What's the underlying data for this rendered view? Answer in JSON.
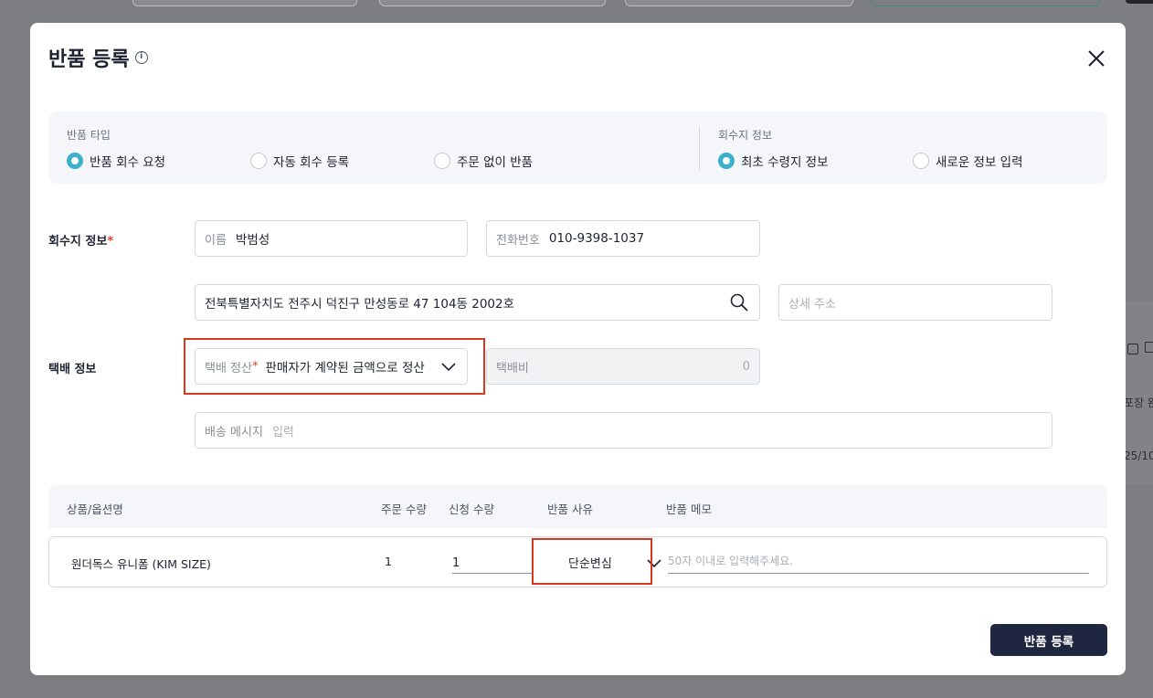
{
  "background": {
    "text_fragments": [
      "포장 완",
      "25/10"
    ]
  },
  "modal": {
    "title": "반품 등록",
    "info_icon": "info-icon",
    "close_icon": "close-icon"
  },
  "return_type": {
    "label": "반품 타입",
    "options": [
      "반품 회수 요청",
      "자동 회수 등록",
      "주문 없이 반품"
    ],
    "selected": "반품 회수 요청"
  },
  "pickup_info": {
    "label": "회수지 정보",
    "options": [
      "최초 수령지 정보",
      "새로운 정보 입력"
    ],
    "selected": "최초 수령지 정보"
  },
  "pickup": {
    "row_label": "회수지 정보",
    "required_mark": "*",
    "name_label": "이름",
    "name_value": "박범성",
    "phone_label": "전화번호",
    "phone_value": "010-9398-1037",
    "address_value": "전북특별자치도 전주시 덕진구 만성동로 47 104동 2002호",
    "detail_address_placeholder": "상세 주소"
  },
  "delivery": {
    "row_label": "택배 정보",
    "settlement_label": "택배 정산",
    "required_mark": "*",
    "settlement_value": "판매자가 계약된 금액으로 정산",
    "fee_label": "택배비",
    "fee_value": "0",
    "message_label": "배송 메시지",
    "message_placeholder": "입력"
  },
  "table": {
    "headers": [
      "상품/옵션명",
      "주문 수량",
      "신청 수량",
      "반품 사유",
      "반품 메모"
    ],
    "rows": [
      {
        "product": "원더독스 유니폼 (KIM SIZE)",
        "order_qty": "1",
        "request_qty": "1",
        "reason": "단순변심",
        "memo_placeholder": "50자 이내로 입력해주세요."
      }
    ]
  },
  "submit_label": "반품 등록",
  "colors": {
    "accent_radio": "#3cb1cc",
    "primary_button": "#1e2640",
    "required": "#e0412a",
    "highlight_box": "#d9381e"
  }
}
